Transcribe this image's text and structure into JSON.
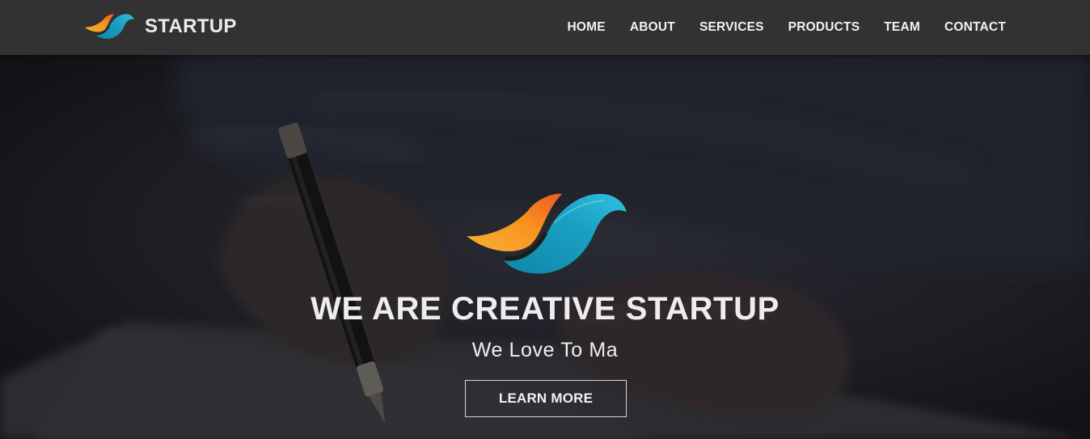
{
  "brand": {
    "name": "STARTUP",
    "logo_icon": "bird-logo-icon"
  },
  "nav": {
    "items": [
      {
        "label": "HOME"
      },
      {
        "label": "ABOUT"
      },
      {
        "label": "SERVICES"
      },
      {
        "label": "PRODUCTS"
      },
      {
        "label": "TEAM"
      },
      {
        "label": "CONTACT"
      }
    ]
  },
  "hero": {
    "logo_icon": "bird-logo-icon",
    "title": "WE ARE CREATIVE STARTUP",
    "subtitle": "We Love To Ma",
    "button_label": "LEARN MORE",
    "background": "hand-writing-with-pen-photo"
  },
  "colors": {
    "navbar_bg": "#323232",
    "logo_orange": "#f7931e",
    "logo_teal": "#1aa0c4",
    "text_light": "#ececec"
  }
}
